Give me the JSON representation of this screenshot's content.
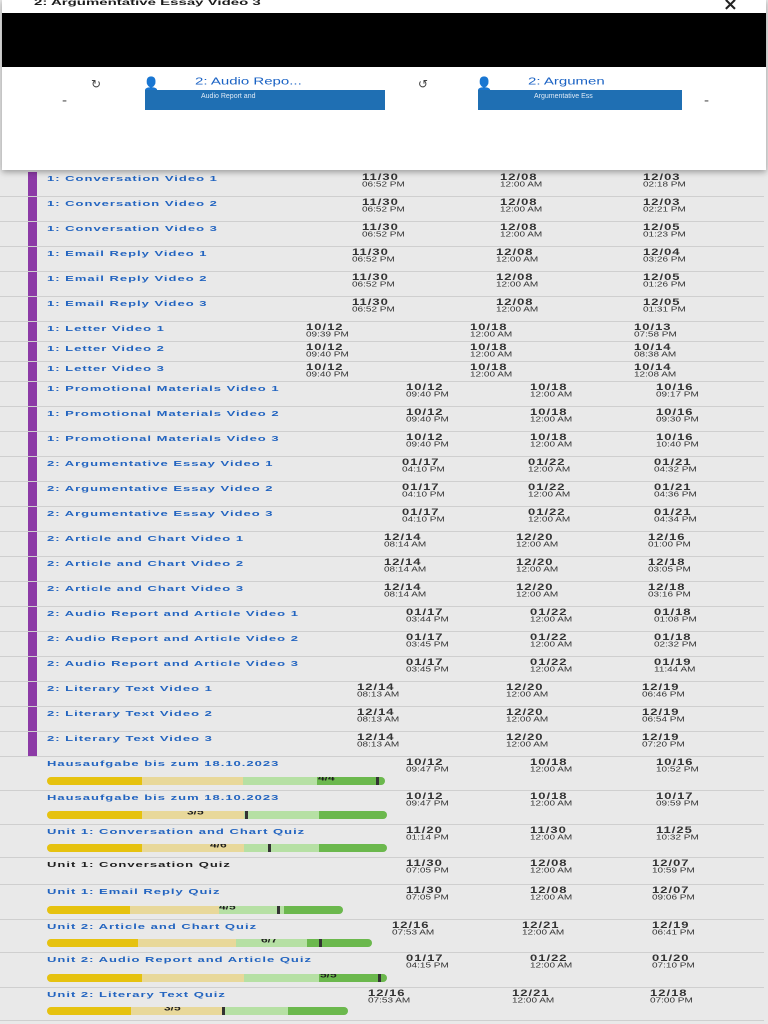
{
  "modal": {
    "title": "2: Argumentative Essay Video 3",
    "close_icon": "×",
    "nav": {
      "prev_icon": "-",
      "next_icon": "-",
      "prev_card": {
        "title": "2: Audio Repo...",
        "thumb": "Audio Report and"
      },
      "next_card": {
        "title": "2: Argumen",
        "thumb": "Argumentative Ess"
      }
    }
  },
  "rows": [
    {
      "title": "1: Conversation Video 1",
      "c1": [
        "11/30",
        "06:52 PM"
      ],
      "c2": [
        "12/08",
        "12:00 AM"
      ],
      "c3": [
        "12/03",
        "02:18 PM"
      ]
    },
    {
      "title": "1: Conversation Video 2",
      "c1": [
        "11/30",
        "06:52 PM"
      ],
      "c2": [
        "12/08",
        "12:00 AM"
      ],
      "c3": [
        "12/03",
        "02:21 PM"
      ]
    },
    {
      "title": "1: Conversation Video 3",
      "c1": [
        "11/30",
        "06:52 PM"
      ],
      "c2": [
        "12/08",
        "12:00 AM"
      ],
      "c3": [
        "12/05",
        "01:23 PM"
      ]
    },
    {
      "title": "1: Email Reply Video 1",
      "c1": [
        "11/30",
        "06:52 PM"
      ],
      "c2": [
        "12/08",
        "12:00 AM"
      ],
      "c3": [
        "12/04",
        "03:26 PM"
      ]
    },
    {
      "title": "1: Email Reply Video 2",
      "c1": [
        "11/30",
        "06:52 PM"
      ],
      "c2": [
        "12/08",
        "12:00 AM"
      ],
      "c3": [
        "12/05",
        "01:26 PM"
      ]
    },
    {
      "title": "1: Email Reply Video 3",
      "c1": [
        "11/30",
        "06:52 PM"
      ],
      "c2": [
        "12/08",
        "12:00 AM"
      ],
      "c3": [
        "12/05",
        "01:31 PM"
      ]
    },
    {
      "title": "1: Letter Video 1",
      "c1": [
        "10/12",
        "09:39 PM"
      ],
      "c2": [
        "10/18",
        "12:00 AM"
      ],
      "c3": [
        "10/13",
        "07:58 PM"
      ]
    },
    {
      "title": "1: Letter Video 2",
      "c1": [
        "10/12",
        "09:40 PM"
      ],
      "c2": [
        "10/18",
        "12:00 AM"
      ],
      "c3": [
        "10/14",
        "08:38 AM"
      ]
    },
    {
      "title": "1: Letter Video 3",
      "c1": [
        "10/12",
        "09:40 PM"
      ],
      "c2": [
        "10/18",
        "12:00 AM"
      ],
      "c3": [
        "10/14",
        "12:08 AM"
      ]
    },
    {
      "title": "1: Promotional Materials Video 1",
      "c1": [
        "10/12",
        "09:40 PM"
      ],
      "c2": [
        "10/18",
        "12:00 AM"
      ],
      "c3": [
        "10/16",
        "09:17 PM"
      ]
    },
    {
      "title": "1: Promotional Materials Video 2",
      "c1": [
        "10/12",
        "09:40 PM"
      ],
      "c2": [
        "10/18",
        "12:00 AM"
      ],
      "c3": [
        "10/16",
        "09:30 PM"
      ]
    },
    {
      "title": "1: Promotional Materials Video 3",
      "c1": [
        "10/12",
        "09:40 PM"
      ],
      "c2": [
        "10/18",
        "12:00 AM"
      ],
      "c3": [
        "10/16",
        "10:40 PM"
      ]
    },
    {
      "title": "2: Argumentative Essay Video 1",
      "c1": [
        "01/17",
        "04:10 PM"
      ],
      "c2": [
        "01/22",
        "12:00 AM"
      ],
      "c3": [
        "01/21",
        "04:32 PM"
      ]
    },
    {
      "title": "2: Argumentative Essay Video 2",
      "c1": [
        "01/17",
        "04:10 PM"
      ],
      "c2": [
        "01/22",
        "12:00 AM"
      ],
      "c3": [
        "01/21",
        "04:36 PM"
      ]
    },
    {
      "title": "2: Argumentative Essay Video 3",
      "c1": [
        "01/17",
        "04:10 PM"
      ],
      "c2": [
        "01/22",
        "12:00 AM"
      ],
      "c3": [
        "01/21",
        "04:34 PM"
      ]
    },
    {
      "title": "2: Article and Chart Video 1",
      "c1": [
        "12/14",
        "08:14 AM"
      ],
      "c2": [
        "12/20",
        "12:00 AM"
      ],
      "c3": [
        "12/16",
        "01:00 PM"
      ]
    },
    {
      "title": "2: Article and Chart Video 2",
      "c1": [
        "12/14",
        "08:14 AM"
      ],
      "c2": [
        "12/20",
        "12:00 AM"
      ],
      "c3": [
        "12/18",
        "03:05 PM"
      ]
    },
    {
      "title": "2: Article and Chart Video 3",
      "c1": [
        "12/14",
        "08:14 AM"
      ],
      "c2": [
        "12/20",
        "12:00 AM"
      ],
      "c3": [
        "12/18",
        "03:16 PM"
      ]
    },
    {
      "title": "2: Audio Report and Article Video 1",
      "c1": [
        "01/17",
        "03:44 PM"
      ],
      "c2": [
        "01/22",
        "12:00 AM"
      ],
      "c3": [
        "01/18",
        "01:08 PM"
      ]
    },
    {
      "title": "2: Audio Report and Article Video 2",
      "c1": [
        "01/17",
        "03:45 PM"
      ],
      "c2": [
        "01/22",
        "12:00 AM"
      ],
      "c3": [
        "01/18",
        "02:32 PM"
      ]
    },
    {
      "title": "2: Audio Report and Article Video 3",
      "c1": [
        "01/17",
        "03:45 PM"
      ],
      "c2": [
        "01/22",
        "12:00 AM"
      ],
      "c3": [
        "01/19",
        "11:44 AM"
      ]
    },
    {
      "title": "2: Literary Text Video 1",
      "c1": [
        "12/14",
        "08:13 AM"
      ],
      "c2": [
        "12/20",
        "12:00 AM"
      ],
      "c3": [
        "12/19",
        "06:46 PM"
      ]
    },
    {
      "title": "2: Literary Text Video 2",
      "c1": [
        "12/14",
        "08:13 AM"
      ],
      "c2": [
        "12/20",
        "12:00 AM"
      ],
      "c3": [
        "12/19",
        "06:54 PM"
      ]
    },
    {
      "title": "2: Literary Text Video 3",
      "c1": [
        "12/14",
        "08:13 AM"
      ],
      "c2": [
        "12/20",
        "12:00 AM"
      ],
      "c3": [
        "12/19",
        "07:20 PM"
      ]
    }
  ],
  "quizzes": [
    {
      "title": "Hausaufgabe bis zum 18.10.2023",
      "score": "4/4",
      "fraction": 1.0,
      "c1": [
        "10/12",
        "09:47 PM"
      ],
      "c2": [
        "10/18",
        "12:00 AM"
      ],
      "c3": [
        "10/16",
        "10:52 PM"
      ]
    },
    {
      "title": "Hausaufgabe bis zum 18.10.2023",
      "score": "3/5",
      "fraction": 0.6,
      "c1": [
        "10/12",
        "09:47 PM"
      ],
      "c2": [
        "10/18",
        "12:00 AM"
      ],
      "c3": [
        "10/17",
        "09:59 PM"
      ]
    },
    {
      "title": "Unit 1: Conversation and Chart Quiz",
      "score": "4/6",
      "fraction": 0.67,
      "c1": [
        "11/20",
        "01:14 PM"
      ],
      "c2": [
        "11/30",
        "12:00 AM"
      ],
      "c3": [
        "11/25",
        "10:32 PM"
      ]
    },
    {
      "title": "Unit 1: Conversation Quiz",
      "score": "",
      "fraction": null,
      "c1": [
        "11/30",
        "07:05 PM"
      ],
      "c2": [
        "12/08",
        "12:00 AM"
      ],
      "c3": [
        "12/07",
        "10:59 PM"
      ]
    },
    {
      "title": "Unit 1: Email Reply Quiz",
      "score": "4/5",
      "fraction": 0.8,
      "c1": [
        "11/30",
        "07:05 PM"
      ],
      "c2": [
        "12/08",
        "12:00 AM"
      ],
      "c3": [
        "12/07",
        "09:06 PM"
      ]
    },
    {
      "title": "Unit 2: Article and Chart Quiz",
      "score": "6/7",
      "fraction": 0.86,
      "c1": [
        "12/16",
        "07:53 AM"
      ],
      "c2": [
        "12/21",
        "12:00 AM"
      ],
      "c3": [
        "12/19",
        "06:41 PM"
      ]
    },
    {
      "title": "Unit 2: Audio Report and Article Quiz",
      "score": "5/5",
      "fraction": 1.0,
      "c1": [
        "01/17",
        "04:15 PM"
      ],
      "c2": [
        "01/22",
        "12:00 AM"
      ],
      "c3": [
        "01/20",
        "07:10 PM"
      ]
    },
    {
      "title": "Unit 2: Literary Text Quiz",
      "score": "3/5",
      "fraction": 0.6,
      "c1": [
        "12/16",
        "07:53 AM"
      ],
      "c2": [
        "12/21",
        "12:00 AM"
      ],
      "c3": [
        "12/18",
        "07:00 PM"
      ]
    }
  ],
  "colors": {
    "group_bar": "#8c3aa6",
    "link": "#2264c0",
    "progress": [
      "#e6c20f",
      "#e8d89a",
      "#b6e0a4",
      "#6bb84d"
    ]
  }
}
